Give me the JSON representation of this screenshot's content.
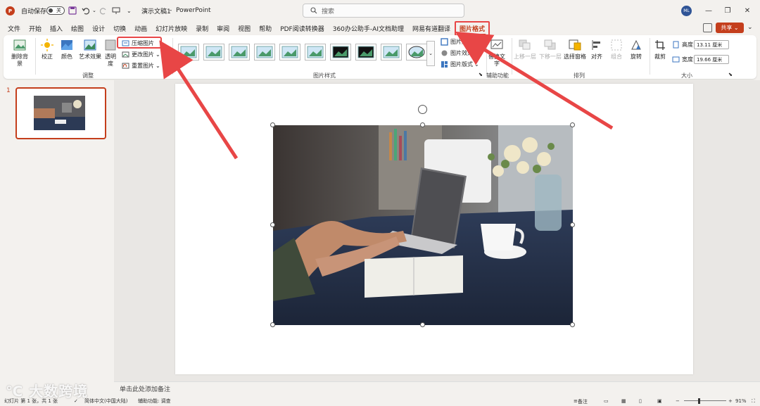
{
  "titlebar": {
    "autosave_label": "自动保存",
    "autosave_state": "关",
    "document_title": "演示文稿1",
    "separator": "-",
    "app_name": "PowerPoint",
    "search_placeholder": "搜索",
    "user_initials": "ML"
  },
  "tabs": [
    "文件",
    "开始",
    "插入",
    "绘图",
    "设计",
    "切换",
    "动画",
    "幻灯片放映",
    "录制",
    "审阅",
    "视图",
    "帮助",
    "PDF阅读转换器",
    "360办公助手-AI文档助理",
    "网易有道翻译",
    "图片格式"
  ],
  "active_tab": "图片格式",
  "share_label": "共享",
  "ribbon": {
    "adjust": {
      "remove_bg": "删除背景",
      "correct": "校正",
      "color": "颜色",
      "artistic": "艺术效果",
      "transparency_1": "透明",
      "transparency_2": "度",
      "compress": "压缩图片",
      "change": "更改图片",
      "reset": "重置图片",
      "group_label": "调整"
    },
    "styles": {
      "border": "图片边框",
      "effects": "图片效果",
      "layout": "图片版式",
      "group_label": "图片样式"
    },
    "accessibility": {
      "alt_text": "替换文字",
      "group_label": "辅助功能"
    },
    "arrange": {
      "bring_forward": "上移一层",
      "send_backward": "下移一层",
      "selection_pane": "选择窗格",
      "align": "对齐",
      "group": "组合",
      "rotate": "旋转",
      "group_label": "排列"
    },
    "size": {
      "crop": "裁剪",
      "height_label": "高度:",
      "height_value": "13.11 厘米",
      "width_label": "宽度:",
      "width_value": "19.66 厘米",
      "group_label": "大小"
    }
  },
  "slides_pane": {
    "slide_number": "1"
  },
  "notes_placeholder": "单击此处添加备注",
  "statusbar": {
    "slide_info": "幻灯片 第 1 张，共 1 张",
    "language": "简体中文(中国大陆)",
    "accessibility": "辅助功能: 调查",
    "notes_btn": "备注",
    "zoom": "91%"
  },
  "watermark": "大数跨境",
  "colors": {
    "accent": "#c43e1c",
    "highlight": "#e84646",
    "ribbon_bg": "#ffffff",
    "app_bg": "#f3f1ee"
  }
}
